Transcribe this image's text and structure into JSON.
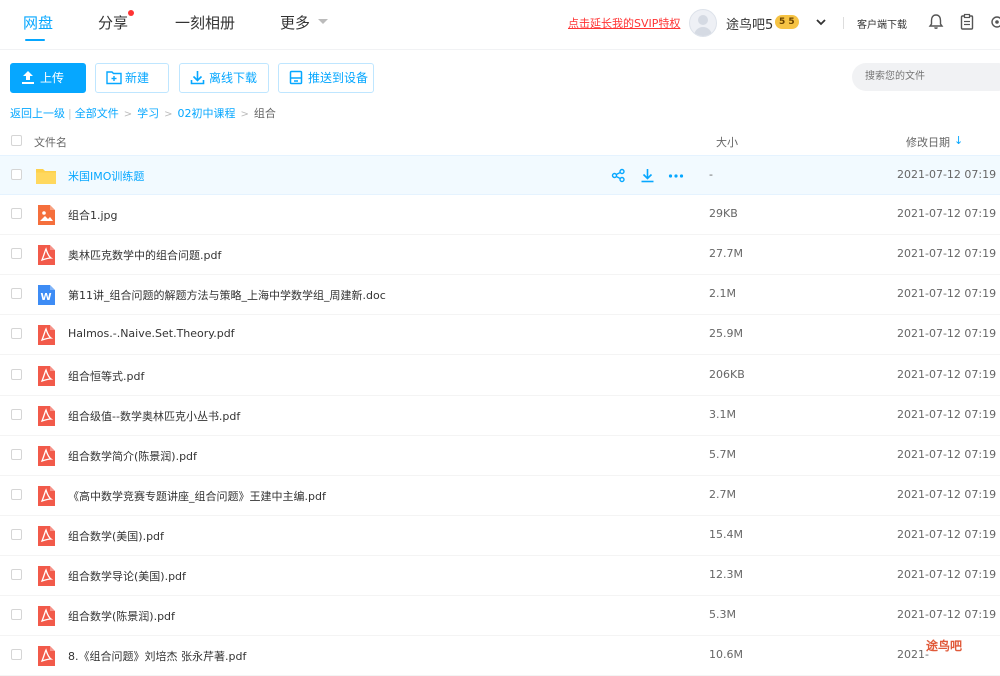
{
  "topnav": {
    "items": [
      {
        "label": "网盘"
      },
      {
        "label": "分享"
      },
      {
        "label": "一刻相册"
      },
      {
        "label": "更多"
      }
    ],
    "promo_link": "点击延长我的SVIP特权",
    "username": "途鸟吧5",
    "svip_badge": "5 5",
    "client_download": "客户端下载"
  },
  "toolbar": {
    "upload": "上传",
    "new": "新建",
    "offline_download": "离线下载",
    "push_device": "推送到设备",
    "search_placeholder": "搜索您的文件"
  },
  "breadcrumb": {
    "back": "返回上一级",
    "all_files": "全部文件",
    "items": [
      "学习",
      "02初中课程"
    ],
    "current": "组合"
  },
  "columns": {
    "name": "文件名",
    "size": "大小",
    "date": "修改日期"
  },
  "files": [
    {
      "name": "米国IMO训练题",
      "size": "-",
      "date": "2021-07-12 07:19",
      "type": "folder"
    },
    {
      "name": "组合1.jpg",
      "size": "29KB",
      "date": "2021-07-12 07:19",
      "type": "image"
    },
    {
      "name": "奥林匹克数学中的组合问题.pdf",
      "size": "27.7M",
      "date": "2021-07-12 07:19",
      "type": "pdf"
    },
    {
      "name": "第11讲_组合问题的解题方法与策略_上海中学数学组_周建新.doc",
      "size": "2.1M",
      "date": "2021-07-12 07:19",
      "type": "doc"
    },
    {
      "name": "Halmos.-.Naive.Set.Theory.pdf",
      "size": "25.9M",
      "date": "2021-07-12 07:19",
      "type": "pdf"
    },
    {
      "name": "组合恒等式.pdf",
      "size": "206KB",
      "date": "2021-07-12 07:19",
      "type": "pdf"
    },
    {
      "name": "组合级值--数学奥林匹克小丛书.pdf",
      "size": "3.1M",
      "date": "2021-07-12 07:19",
      "type": "pdf"
    },
    {
      "name": "组合数学简介(陈景润).pdf",
      "size": "5.7M",
      "date": "2021-07-12 07:19",
      "type": "pdf"
    },
    {
      "name": "《高中数学竞赛专题讲座_组合问题》王建中主编.pdf",
      "size": "2.7M",
      "date": "2021-07-12 07:19",
      "type": "pdf"
    },
    {
      "name": "组合数学(美国).pdf",
      "size": "15.4M",
      "date": "2021-07-12 07:19",
      "type": "pdf"
    },
    {
      "name": "组合数学导论(美国).pdf",
      "size": "12.3M",
      "date": "2021-07-12 07:19",
      "type": "pdf"
    },
    {
      "name": "组合数学(陈景润).pdf",
      "size": "5.3M",
      "date": "2021-07-12 07:19",
      "type": "pdf"
    },
    {
      "name": "8.《组合问题》刘培杰 张永芹著.pdf",
      "size": "10.6M",
      "date": "2021-",
      "type": "pdf"
    }
  ],
  "watermark": "途鸟吧",
  "colors": {
    "accent": "#06a7ff",
    "promo": "#ff3333",
    "pdf": "#f25a4a",
    "image": "#f56f3c",
    "doc": "#3d8cf5",
    "folder": "#fdd14c"
  }
}
